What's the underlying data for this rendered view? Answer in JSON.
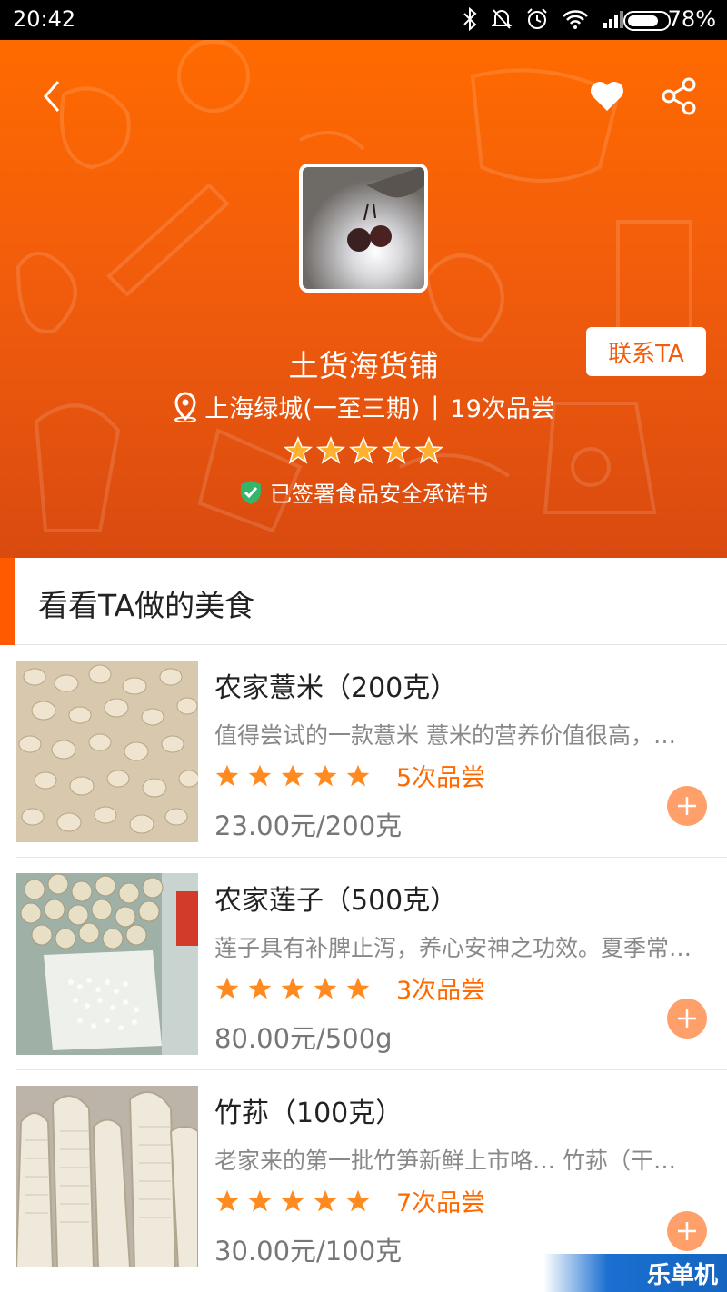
{
  "status_bar": {
    "time": "20:42",
    "battery_percent": "78%",
    "battery_level": 0.78,
    "icons": [
      "bluetooth-icon",
      "bell-off-icon",
      "alarm-icon",
      "wifi-icon",
      "signal-icon",
      "battery-icon"
    ]
  },
  "header": {
    "back_icon": "chevron-left-icon",
    "favorite_icon": "heart-icon",
    "share_icon": "share-icon",
    "contact_label": "联系TA",
    "shop_name": "土货海货铺",
    "location": "上海绿城(一至三期)",
    "separator": "|",
    "tastes": "19次品尝",
    "rating": 5,
    "safety_text": "已签署食品安全承诺书",
    "accent_color": "#f25d0c"
  },
  "section": {
    "title": "看看TA做的美食"
  },
  "items": [
    {
      "name": "农家薏米（200克）",
      "desc": "值得尝试的一款薏米 薏米的营养价值很高，…",
      "rating": 5,
      "tastes": "5次品尝",
      "price": "23.00元/200克"
    },
    {
      "name": "农家莲子（500克）",
      "desc": "莲子具有补脾止泻，养心安神之功效。夏季常…",
      "rating": 5,
      "tastes": "3次品尝",
      "price": "80.00元/500g"
    },
    {
      "name": "竹荪（100克）",
      "desc": "老家来的第一批竹笋新鲜上市咯… 竹荪（干…",
      "rating": 5,
      "tastes": "7次品尝",
      "price": "30.00元/100克"
    }
  ],
  "watermark": "乐单机",
  "colors": {
    "star": "#ff8a1f",
    "tastes_text": "#ff6a00",
    "add_button": "#ffa06b"
  }
}
